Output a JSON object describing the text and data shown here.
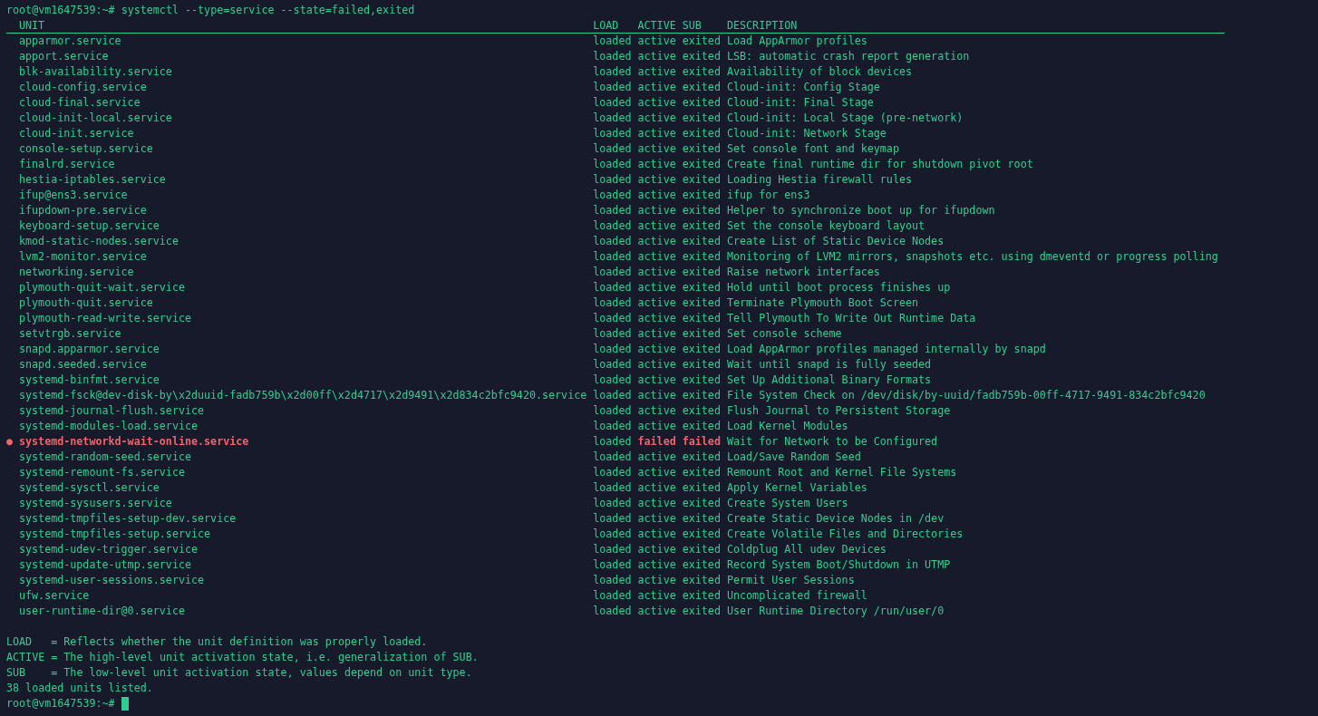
{
  "command": {
    "prompt": "root@vm1647539:~#",
    "text": "systemctl --type=service --state=failed,exited"
  },
  "table": {
    "columns": [
      "UNIT",
      "LOAD",
      "ACTIVE",
      "SUB",
      "DESCRIPTION"
    ],
    "rows": [
      {
        "unit": "apparmor.service",
        "load": "loaded",
        "active": "active",
        "sub": "exited",
        "description": "Load AppArmor profiles",
        "failed": false
      },
      {
        "unit": "apport.service",
        "load": "loaded",
        "active": "active",
        "sub": "exited",
        "description": "LSB: automatic crash report generation",
        "failed": false
      },
      {
        "unit": "blk-availability.service",
        "load": "loaded",
        "active": "active",
        "sub": "exited",
        "description": "Availability of block devices",
        "failed": false
      },
      {
        "unit": "cloud-config.service",
        "load": "loaded",
        "active": "active",
        "sub": "exited",
        "description": "Cloud-init: Config Stage",
        "failed": false
      },
      {
        "unit": "cloud-final.service",
        "load": "loaded",
        "active": "active",
        "sub": "exited",
        "description": "Cloud-init: Final Stage",
        "failed": false
      },
      {
        "unit": "cloud-init-local.service",
        "load": "loaded",
        "active": "active",
        "sub": "exited",
        "description": "Cloud-init: Local Stage (pre-network)",
        "failed": false
      },
      {
        "unit": "cloud-init.service",
        "load": "loaded",
        "active": "active",
        "sub": "exited",
        "description": "Cloud-init: Network Stage",
        "failed": false
      },
      {
        "unit": "console-setup.service",
        "load": "loaded",
        "active": "active",
        "sub": "exited",
        "description": "Set console font and keymap",
        "failed": false
      },
      {
        "unit": "finalrd.service",
        "load": "loaded",
        "active": "active",
        "sub": "exited",
        "description": "Create final runtime dir for shutdown pivot root",
        "failed": false
      },
      {
        "unit": "hestia-iptables.service",
        "load": "loaded",
        "active": "active",
        "sub": "exited",
        "description": "Loading Hestia firewall rules",
        "failed": false
      },
      {
        "unit": "ifup@ens3.service",
        "load": "loaded",
        "active": "active",
        "sub": "exited",
        "description": "ifup for ens3",
        "failed": false
      },
      {
        "unit": "ifupdown-pre.service",
        "load": "loaded",
        "active": "active",
        "sub": "exited",
        "description": "Helper to synchronize boot up for ifupdown",
        "failed": false
      },
      {
        "unit": "keyboard-setup.service",
        "load": "loaded",
        "active": "active",
        "sub": "exited",
        "description": "Set the console keyboard layout",
        "failed": false
      },
      {
        "unit": "kmod-static-nodes.service",
        "load": "loaded",
        "active": "active",
        "sub": "exited",
        "description": "Create List of Static Device Nodes",
        "failed": false
      },
      {
        "unit": "lvm2-monitor.service",
        "load": "loaded",
        "active": "active",
        "sub": "exited",
        "description": "Monitoring of LVM2 mirrors, snapshots etc. using dmeventd or progress polling",
        "failed": false
      },
      {
        "unit": "networking.service",
        "load": "loaded",
        "active": "active",
        "sub": "exited",
        "description": "Raise network interfaces",
        "failed": false
      },
      {
        "unit": "plymouth-quit-wait.service",
        "load": "loaded",
        "active": "active",
        "sub": "exited",
        "description": "Hold until boot process finishes up",
        "failed": false
      },
      {
        "unit": "plymouth-quit.service",
        "load": "loaded",
        "active": "active",
        "sub": "exited",
        "description": "Terminate Plymouth Boot Screen",
        "failed": false
      },
      {
        "unit": "plymouth-read-write.service",
        "load": "loaded",
        "active": "active",
        "sub": "exited",
        "description": "Tell Plymouth To Write Out Runtime Data",
        "failed": false
      },
      {
        "unit": "setvtrgb.service",
        "load": "loaded",
        "active": "active",
        "sub": "exited",
        "description": "Set console scheme",
        "failed": false
      },
      {
        "unit": "snapd.apparmor.service",
        "load": "loaded",
        "active": "active",
        "sub": "exited",
        "description": "Load AppArmor profiles managed internally by snapd",
        "failed": false
      },
      {
        "unit": "snapd.seeded.service",
        "load": "loaded",
        "active": "active",
        "sub": "exited",
        "description": "Wait until snapd is fully seeded",
        "failed": false
      },
      {
        "unit": "systemd-binfmt.service",
        "load": "loaded",
        "active": "active",
        "sub": "exited",
        "description": "Set Up Additional Binary Formats",
        "failed": false
      },
      {
        "unit": "systemd-fsck@dev-disk-by\\x2duuid-fadb759b\\x2d00ff\\x2d4717\\x2d9491\\x2d834c2bfc9420.service",
        "load": "loaded",
        "active": "active",
        "sub": "exited",
        "description": "File System Check on /dev/disk/by-uuid/fadb759b-00ff-4717-9491-834c2bfc9420",
        "failed": false
      },
      {
        "unit": "systemd-journal-flush.service",
        "load": "loaded",
        "active": "active",
        "sub": "exited",
        "description": "Flush Journal to Persistent Storage",
        "failed": false
      },
      {
        "unit": "systemd-modules-load.service",
        "load": "loaded",
        "active": "active",
        "sub": "exited",
        "description": "Load Kernel Modules",
        "failed": false
      },
      {
        "marker": "●",
        "unit": "systemd-networkd-wait-online.service",
        "load": "loaded",
        "active": "failed",
        "sub": "failed",
        "description": "Wait for Network to be Configured",
        "failed": true
      },
      {
        "unit": "systemd-random-seed.service",
        "load": "loaded",
        "active": "active",
        "sub": "exited",
        "description": "Load/Save Random Seed",
        "failed": false
      },
      {
        "unit": "systemd-remount-fs.service",
        "load": "loaded",
        "active": "active",
        "sub": "exited",
        "description": "Remount Root and Kernel File Systems",
        "failed": false
      },
      {
        "unit": "systemd-sysctl.service",
        "load": "loaded",
        "active": "active",
        "sub": "exited",
        "description": "Apply Kernel Variables",
        "failed": false
      },
      {
        "unit": "systemd-sysusers.service",
        "load": "loaded",
        "active": "active",
        "sub": "exited",
        "description": "Create System Users",
        "failed": false
      },
      {
        "unit": "systemd-tmpfiles-setup-dev.service",
        "load": "loaded",
        "active": "active",
        "sub": "exited",
        "description": "Create Static Device Nodes in /dev",
        "failed": false
      },
      {
        "unit": "systemd-tmpfiles-setup.service",
        "load": "loaded",
        "active": "active",
        "sub": "exited",
        "description": "Create Volatile Files and Directories",
        "failed": false
      },
      {
        "unit": "systemd-udev-trigger.service",
        "load": "loaded",
        "active": "active",
        "sub": "exited",
        "description": "Coldplug All udev Devices",
        "failed": false
      },
      {
        "unit": "systemd-update-utmp.service",
        "load": "loaded",
        "active": "active",
        "sub": "exited",
        "description": "Record System Boot/Shutdown in UTMP",
        "failed": false
      },
      {
        "unit": "systemd-user-sessions.service",
        "load": "loaded",
        "active": "active",
        "sub": "exited",
        "description": "Permit User Sessions",
        "failed": false
      },
      {
        "unit": "ufw.service",
        "load": "loaded",
        "active": "active",
        "sub": "exited",
        "description": "Uncomplicated firewall",
        "failed": false
      },
      {
        "unit": "user-runtime-dir@0.service",
        "load": "loaded",
        "active": "active",
        "sub": "exited",
        "description": "User Runtime Directory /run/user/0",
        "failed": false
      }
    ]
  },
  "legend": [
    "LOAD   = Reflects whether the unit definition was properly loaded.",
    "ACTIVE = The high-level unit activation state, i.e. generalization of SUB.",
    "SUB    = The low-level unit activation state, values depend on unit type."
  ],
  "summary": "38 loaded units listed.",
  "prompt": "root@vm1647539:~#"
}
